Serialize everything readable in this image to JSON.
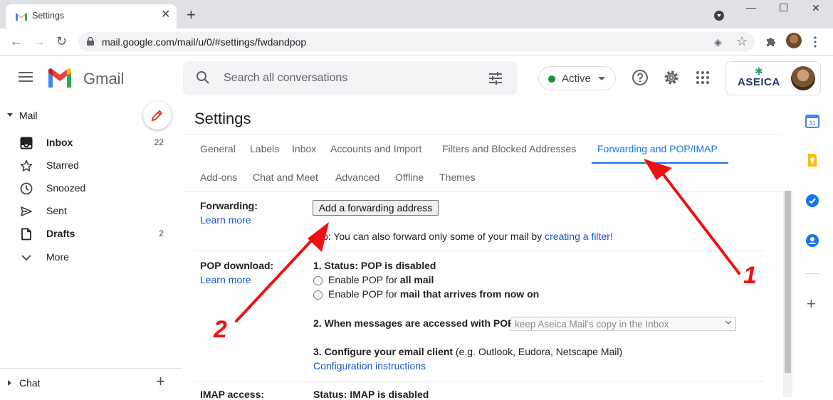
{
  "browser": {
    "tab_title": "Settings",
    "url": "mail.google.com/mail/u/0/#settings/fwdandpop"
  },
  "header": {
    "brand": "Gmail",
    "search_placeholder": "Search all conversations",
    "status_label": "Active",
    "status_color": "#1e8e3e",
    "account_org": "ASEICA"
  },
  "sidebar": {
    "section_mail": "Mail",
    "items": [
      {
        "label": "Inbox",
        "count": "22",
        "icon": "inbox-icon",
        "bold": true
      },
      {
        "label": "Starred",
        "count": "",
        "icon": "star-icon",
        "bold": false
      },
      {
        "label": "Snoozed",
        "count": "",
        "icon": "clock-icon",
        "bold": false
      },
      {
        "label": "Sent",
        "count": "",
        "icon": "send-icon",
        "bold": false
      },
      {
        "label": "Drafts",
        "count": "2",
        "icon": "draft-icon",
        "bold": true
      },
      {
        "label": "More",
        "count": "",
        "icon": "chevron-down-icon",
        "bold": false
      }
    ],
    "section_chat": "Chat"
  },
  "settings": {
    "title": "Settings",
    "tabs_row1": [
      "General",
      "Labels",
      "Inbox",
      "Accounts and Import",
      "Filters and Blocked Addresses",
      "Forwarding and POP/IMAP"
    ],
    "tabs_row2": [
      "Add-ons",
      "Chat and Meet",
      "Advanced",
      "Offline",
      "Themes"
    ],
    "active_tab": "Forwarding and POP/IMAP",
    "forwarding": {
      "label": "Forwarding:",
      "learn_more": "Learn more",
      "button": "Add a forwarding address",
      "tip_prefix": "p: You can also forward only some of your mail by ",
      "tip_link": "creating a filter!"
    },
    "pop": {
      "label": "POP download:",
      "learn_more": "Learn more",
      "status": "1. Status: POP is disabled",
      "opt1_prefix": "Enable POP for ",
      "opt1_bold": "all mail",
      "opt2_prefix": "Enable POP for ",
      "opt2_bold": "mail that arrives from now on",
      "when_label": "2. When messages are accessed with POP",
      "when_value": "keep Aseica Mail's copy in the Inbox",
      "configure_label": "3. Configure your email client",
      "configure_note": " (e.g. Outlook, Eudora, Netscape Mail)",
      "config_link": "Configuration instructions"
    },
    "imap": {
      "label": "IMAP access:",
      "status": "Status: IMAP is disabled"
    }
  },
  "annotations": {
    "arrow_color": "#ee1111",
    "labels": [
      "1",
      "2"
    ]
  }
}
